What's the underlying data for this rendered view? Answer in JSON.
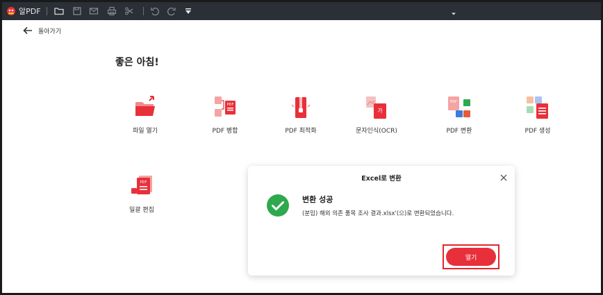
{
  "app": {
    "name": "알PDF",
    "colors": {
      "titlebar": "#2b2f36",
      "accent": "#e8303a",
      "success": "#2fa94e"
    }
  },
  "toolbar": {
    "icons": [
      "folder-icon",
      "save-icon",
      "mail-icon",
      "print-icon",
      "scissors-icon",
      "undo-icon",
      "redo-icon",
      "dropdown-arrow-icon"
    ]
  },
  "nav": {
    "back_label": "돌아가기"
  },
  "greeting": "좋은 아침!",
  "tools": [
    {
      "label": "파일 열기",
      "icon": "open-folder-icon"
    },
    {
      "label": "PDF 병합",
      "icon": "pdf-merge-icon"
    },
    {
      "label": "PDF 최적화",
      "icon": "pdf-compress-icon"
    },
    {
      "label": "문자인식(OCR)",
      "icon": "ocr-icon"
    },
    {
      "label": "PDF 변환",
      "icon": "pdf-convert-icon"
    },
    {
      "label": "PDF 생성",
      "icon": "pdf-create-icon"
    },
    {
      "label": "일괄 편집",
      "icon": "batch-edit-icon"
    }
  ],
  "dialog": {
    "title": "Excel로 변환",
    "heading": "변환 성공",
    "message": "(분임) 해외 의존 품목 조사 결과.xlsx'(으)로 변환되었습니다.",
    "open_label": "열기"
  }
}
